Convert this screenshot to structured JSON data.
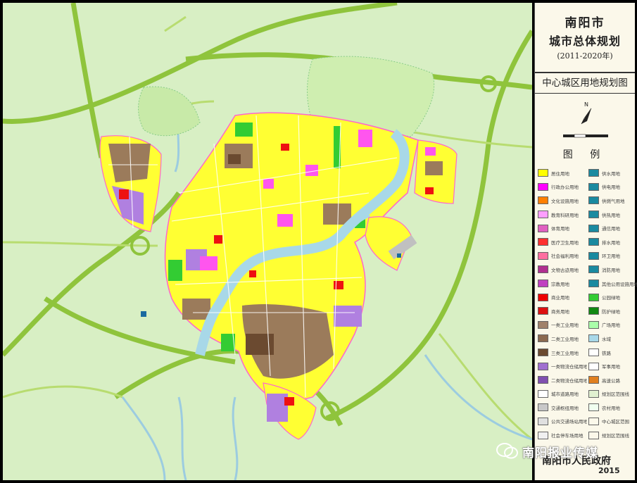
{
  "title": {
    "city": "南阳市",
    "plan": "城市总体规划",
    "years": "(2011-2020年)"
  },
  "subtitle": "中心城区用地规划图",
  "legend_title": "图 例",
  "legend_left": [
    {
      "label": "居住用地",
      "color": "#ffff00"
    },
    {
      "label": "行政办公用地",
      "color": "#ff00ff"
    },
    {
      "label": "文化设施用地",
      "color": "#ff7f00"
    },
    {
      "label": "教育科研用地",
      "color": "#ff9fff"
    },
    {
      "label": "体育用地",
      "color": "#e060c0"
    },
    {
      "label": "医疗卫生用地",
      "color": "#ff3030"
    },
    {
      "label": "社会福利用地",
      "color": "#ff6fa0"
    },
    {
      "label": "文物古迹用地",
      "color": "#b03090"
    },
    {
      "label": "宗教用地",
      "color": "#c040c0"
    },
    {
      "label": "商业用地",
      "color": "#ee0000"
    },
    {
      "label": "商务用地",
      "color": "#dd1111"
    },
    {
      "label": "一类工业用地",
      "color": "#a0826b"
    },
    {
      "label": "二类工业用地",
      "color": "#8b6a50"
    },
    {
      "label": "三类工业用地",
      "color": "#6b4a30"
    },
    {
      "label": "一类物流仓储用地",
      "color": "#a070d0"
    },
    {
      "label": "二类物流仓储用地",
      "color": "#8050b0"
    },
    {
      "label": "城市道路用地",
      "color": "#ffffff"
    },
    {
      "label": "交通枢纽用地",
      "color": "#c8c8c8"
    },
    {
      "label": "公共交通场站用地",
      "color": "#e0e0e0"
    },
    {
      "label": "社会停车场用地",
      "color": "#f0f0f0"
    }
  ],
  "legend_right": [
    {
      "label": "供水用地",
      "color": "#1a8aa0"
    },
    {
      "label": "供电用地",
      "color": "#1a8aa0"
    },
    {
      "label": "供燃气用地",
      "color": "#1a8aa0"
    },
    {
      "label": "供热用地",
      "color": "#1a8aa0"
    },
    {
      "label": "通信用地",
      "color": "#1a8aa0"
    },
    {
      "label": "排水用地",
      "color": "#1a8aa0"
    },
    {
      "label": "环卫用地",
      "color": "#1a8aa0"
    },
    {
      "label": "消防用地",
      "color": "#1a8aa0"
    },
    {
      "label": "其他公用设施用地",
      "color": "#1a8aa0"
    },
    {
      "label": "公园绿地",
      "color": "#33cc33"
    },
    {
      "label": "防护绿地",
      "color": "#118811"
    },
    {
      "label": "广场用地",
      "color": "#aaffaa"
    },
    {
      "label": "水域",
      "color": "#a8d8e8"
    },
    {
      "label": "铁路",
      "color": "#ffffff"
    },
    {
      "label": "军事用地",
      "color": "#ffffff"
    },
    {
      "label": "高速公路",
      "color": "#e08020"
    },
    {
      "label": "规划区范围线",
      "color": "#e0f0d0"
    },
    {
      "label": "农村用地",
      "color": "#f0fff0"
    },
    {
      "label": "中心城区范围",
      "color": "#fbf8ea"
    },
    {
      "label": "规划区范围线",
      "color": "#fbf8ea"
    }
  ],
  "footer": {
    "org": "南阳市人民政府",
    "year": "2015"
  },
  "watermark": "南阳报业传媒",
  "colors": {
    "background": "#d8efc4",
    "road": "#a8d050",
    "river": "#a8d8e8",
    "residential": "#ffff00"
  }
}
